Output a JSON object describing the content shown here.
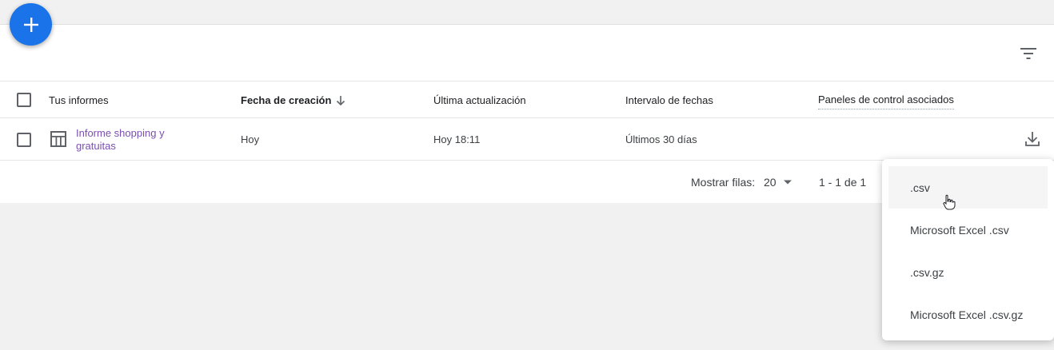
{
  "fab": {
    "icon": "plus-icon"
  },
  "toolbar": {
    "filter_icon": "filter-list-icon"
  },
  "table": {
    "headers": {
      "name": "Tus informes",
      "created": "Fecha de creación",
      "created_sort_icon": "arrow-down-icon",
      "updated": "Última actualización",
      "range": "Intervalo de fechas",
      "panels": "Paneles de control asociados"
    },
    "rows": [
      {
        "icon": "table-report-icon",
        "name": "Informe shopping y gratuitas",
        "created": "Hoy",
        "updated": "Hoy 18:11",
        "range": "Últimos 30 días",
        "action_icon": "download-icon"
      }
    ]
  },
  "pager": {
    "rows_label": "Mostrar filas:",
    "rows_value": "20",
    "range": "1 - 1 de 1"
  },
  "download_menu": {
    "items": [
      ".csv",
      "Microsoft Excel .csv",
      ".csv.gz",
      "Microsoft Excel .csv.gz"
    ],
    "hovered_index": 0
  },
  "colors": {
    "accent": "#1a73e8",
    "link": "#7b4fb0",
    "background": "#f1f1f1"
  }
}
